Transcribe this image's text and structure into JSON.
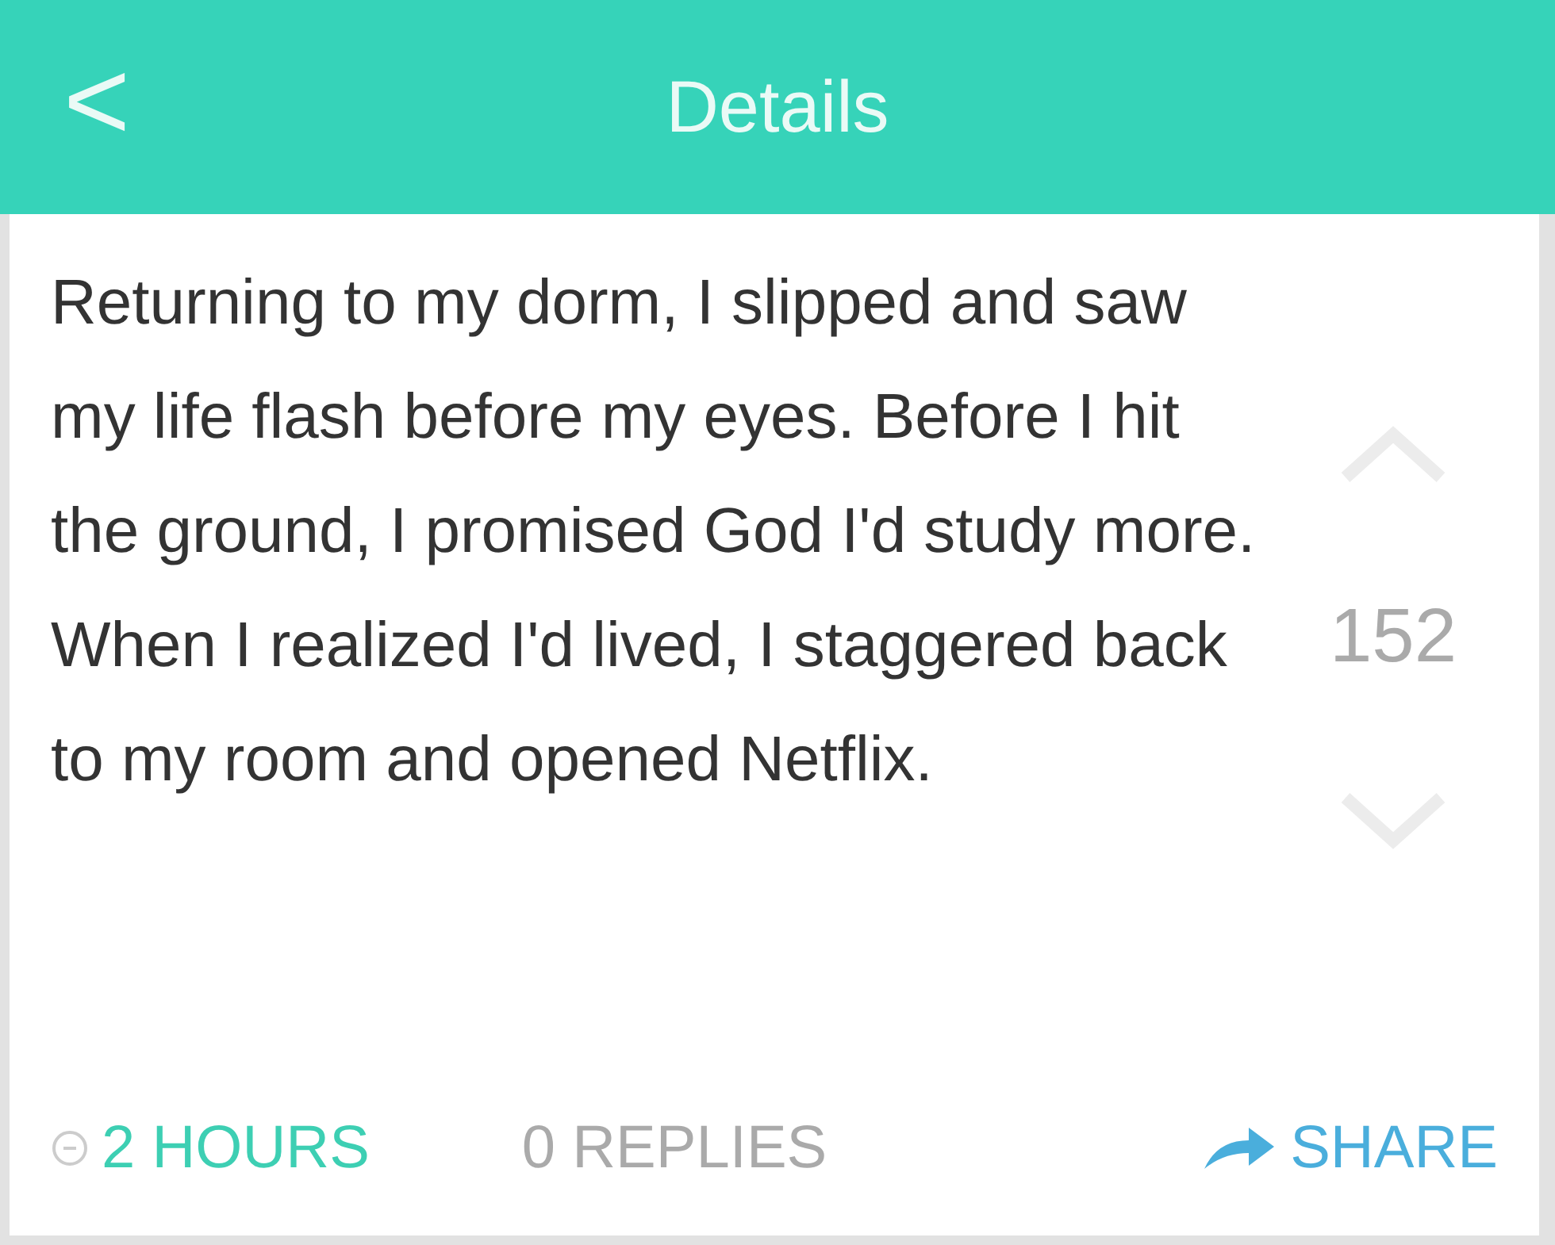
{
  "header": {
    "back": "<",
    "title": "Details"
  },
  "post": {
    "text": "Returning to my dorm, I slipped and saw my life flash before my eyes. Before I hit the ground, I promised God I'd study more. When I realized I'd lived, I staggered back to my room and opened Netflix.",
    "score": "152"
  },
  "footer": {
    "time": "2 HOURS",
    "replies": "0 REPLIES",
    "share": "SHARE"
  }
}
